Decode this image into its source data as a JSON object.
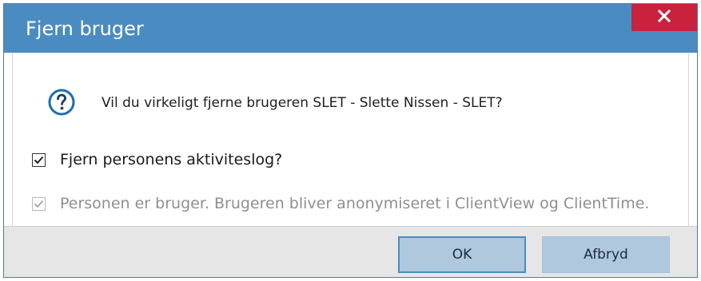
{
  "dialog": {
    "title": "Fjern bruger",
    "close_icon": "close-icon",
    "question_icon": "question-icon",
    "message": "Vil du virkeligt fjerne brugeren SLET - Slette Nissen - SLET?",
    "options": [
      {
        "label": "Fjern personens aktiviteslog?",
        "checked": true,
        "enabled": true
      },
      {
        "label": "Personen er bruger. Brugeren bliver anonymiseret i ClientView og ClientTime.",
        "checked": true,
        "enabled": false
      }
    ],
    "buttons": {
      "ok": "OK",
      "cancel": "Afbryd"
    }
  },
  "colors": {
    "titlebar": "#4a8cc2",
    "close": "#c8223c",
    "button": "#afc8de",
    "footer": "#e6e6e6"
  }
}
